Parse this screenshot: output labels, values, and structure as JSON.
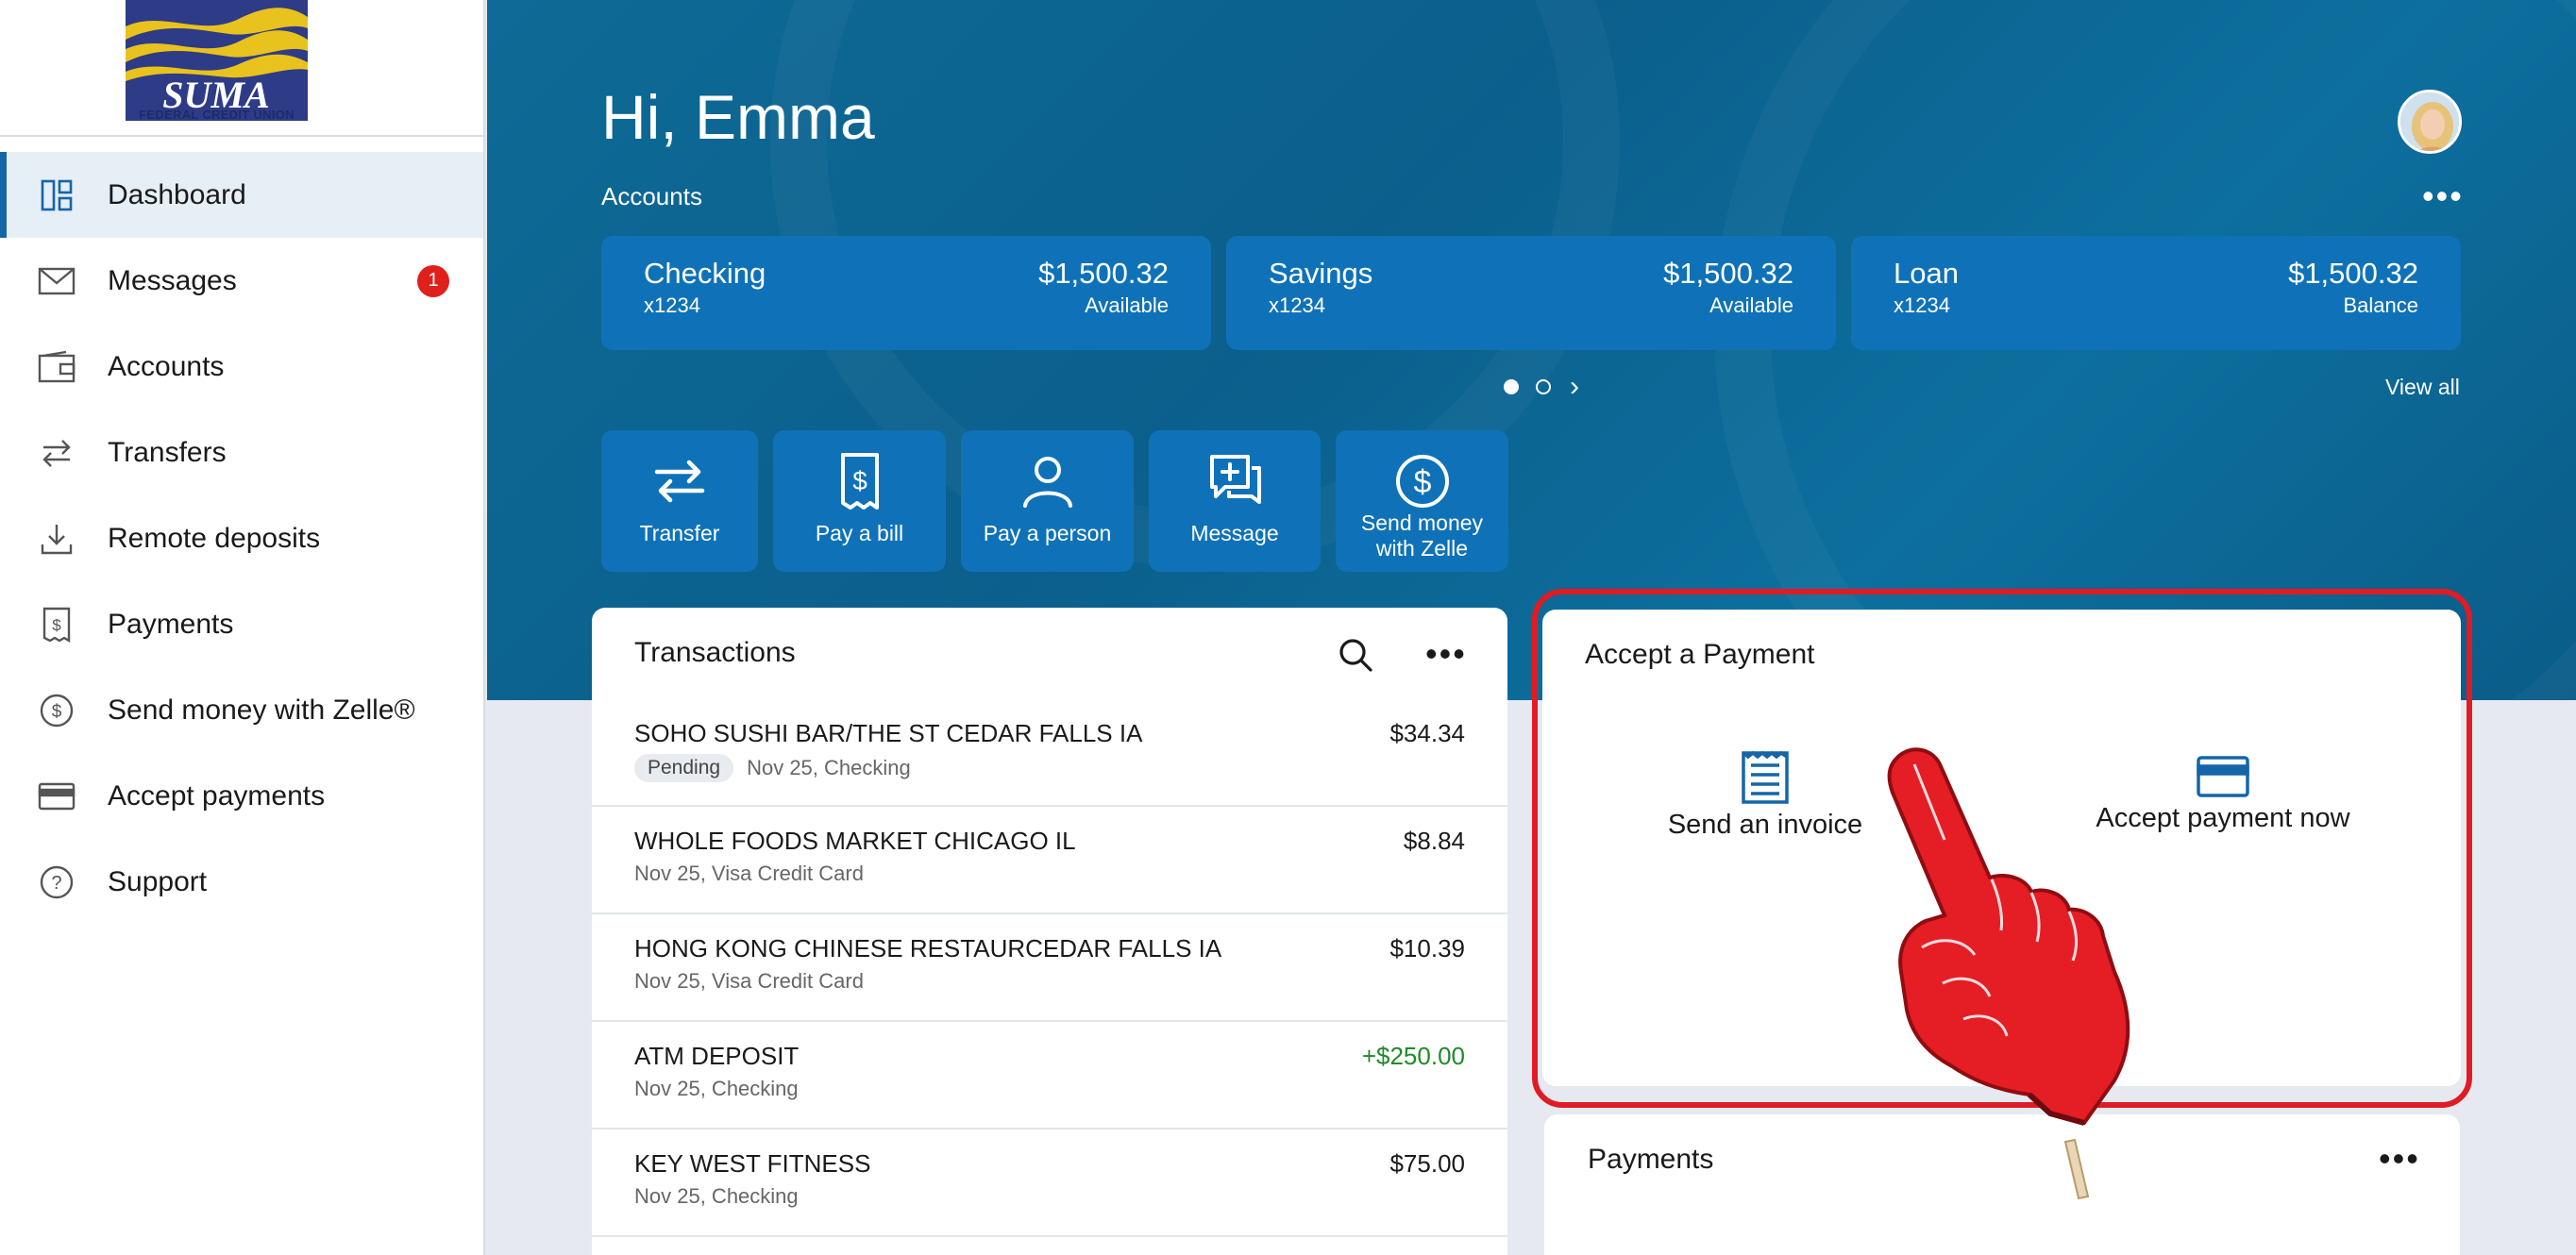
{
  "brand": {
    "logo_text": "SUMA",
    "logo_subtext": "FEDERAL CREDIT UNION",
    "colors": {
      "primary": "#1565a8",
      "hero": "#0b5f8c",
      "card": "#0f72b8",
      "highlight": "#e01b24",
      "positive": "#1f8a28",
      "badge": "#e0201b"
    }
  },
  "sidebar": {
    "items": [
      {
        "label": "Dashboard",
        "icon": "dashboard-icon",
        "active": true
      },
      {
        "label": "Messages",
        "icon": "envelope-icon",
        "badge": "1"
      },
      {
        "label": "Accounts",
        "icon": "wallet-icon"
      },
      {
        "label": "Transfers",
        "icon": "transfer-arrows-icon"
      },
      {
        "label": "Remote deposits",
        "icon": "download-tray-icon"
      },
      {
        "label": "Payments",
        "icon": "bill-icon"
      },
      {
        "label": "Send money with Zelle®",
        "icon": "dollar-circle-icon"
      },
      {
        "label": "Accept payments",
        "icon": "credit-card-icon"
      },
      {
        "label": "Support",
        "icon": "question-circle-icon"
      }
    ]
  },
  "header": {
    "greeting": "Hi, Emma",
    "accounts_label": "Accounts",
    "more_icon": "ellipsis-icon",
    "view_all": "View all",
    "carousel_page": 1,
    "carousel_pages": 2
  },
  "accounts": [
    {
      "name": "Checking",
      "number": "x1234",
      "amount": "$1,500.32",
      "sub": "Available"
    },
    {
      "name": "Savings",
      "number": "x1234",
      "amount": "$1,500.32",
      "sub": "Available"
    },
    {
      "name": "Loan",
      "number": "x1234",
      "amount": "$1,500.32",
      "sub": "Balance"
    }
  ],
  "actions": [
    {
      "label": "Transfer",
      "icon": "transfer-arrows-icon"
    },
    {
      "label": "Pay a bill",
      "icon": "bill-icon"
    },
    {
      "label": "Pay a person",
      "icon": "person-icon"
    },
    {
      "label": "Message",
      "icon": "message-plus-icon"
    },
    {
      "label_line1": "Send money",
      "label_line2": "with Zelle",
      "icon": "dollar-circle-icon"
    }
  ],
  "transactions": {
    "title": "Transactions",
    "rows": [
      {
        "name": "SOHO SUSHI BAR/THE ST CEDAR FALLS IA",
        "status": "Pending",
        "meta": "Nov 25, Checking",
        "amount": "$34.34"
      },
      {
        "name": "WHOLE FOODS MARKET CHICAGO IL",
        "meta": "Nov 25, Visa Credit Card",
        "amount": "$8.84"
      },
      {
        "name": "HONG KONG CHINESE RESTAURCEDAR FALLS IA",
        "meta": "Nov 25, Visa Credit Card",
        "amount": "$10.39"
      },
      {
        "name": "ATM DEPOSIT",
        "meta": "Nov 25, Checking",
        "amount": "+$250.00"
      },
      {
        "name": "KEY WEST FITNESS",
        "meta": "Nov 25, Checking",
        "amount": "$75.00"
      }
    ]
  },
  "accept_payment": {
    "title": "Accept a Payment",
    "send_invoice": "Send an invoice",
    "accept_now": "Accept payment now"
  },
  "payments": {
    "title": "Payments"
  }
}
